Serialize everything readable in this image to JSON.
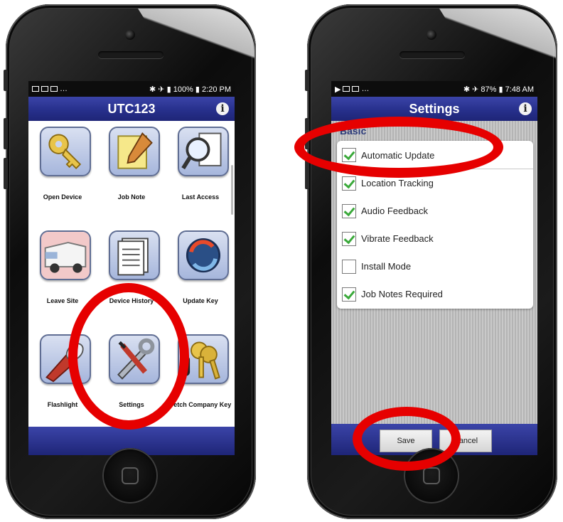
{
  "left_phone": {
    "status": {
      "time": "2:20 PM",
      "battery": "100%"
    },
    "title": "UTC123",
    "info": "i",
    "tiles": [
      {
        "label": "Open Device",
        "icon": "key-icon"
      },
      {
        "label": "Job Note",
        "icon": "notepad-pencil-icon"
      },
      {
        "label": "Last Access",
        "icon": "magnifier-document-icon"
      },
      {
        "label": "Leave Site",
        "icon": "van-icon"
      },
      {
        "label": "Device History",
        "icon": "documents-icon"
      },
      {
        "label": "Update Key",
        "icon": "refresh-icon"
      },
      {
        "label": "Flashlight",
        "icon": "flashlight-icon"
      },
      {
        "label": "Settings",
        "icon": "wrench-screwdriver-icon"
      },
      {
        "label": "Fetch Company Key",
        "icon": "keys-icon"
      }
    ]
  },
  "right_phone": {
    "status": {
      "time": "7:48 AM",
      "battery": "87%"
    },
    "title": "Settings",
    "info": "i",
    "section": "Basic",
    "options": [
      {
        "label": "Automatic Update",
        "checked": true
      },
      {
        "label": "Location Tracking",
        "checked": true
      },
      {
        "label": "Audio Feedback",
        "checked": true
      },
      {
        "label": "Vibrate Feedback",
        "checked": true
      },
      {
        "label": "Install Mode",
        "checked": false
      },
      {
        "label": "Job Notes Required",
        "checked": true
      }
    ],
    "save_label": "Save",
    "cancel_label": "Cancel"
  },
  "colors": {
    "accent": "#27308c",
    "annotation": "#e60000",
    "check": "#3aa93a"
  }
}
